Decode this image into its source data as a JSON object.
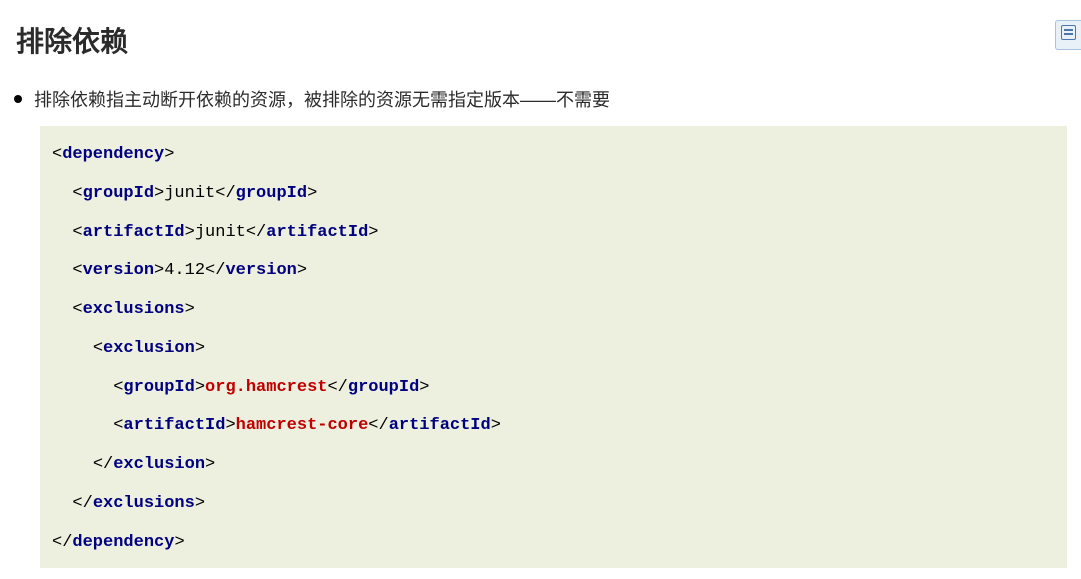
{
  "title": "排除依赖",
  "bullet": "排除依赖指主动断开依赖的资源，被排除的资源无需指定版本——不需要",
  "code": {
    "lines": [
      {
        "indent": 0,
        "open": "dependency",
        "close": null,
        "content": null,
        "contentClass": null
      },
      {
        "indent": 1,
        "open": "groupId",
        "close": "groupId",
        "content": "junit",
        "contentClass": "txt"
      },
      {
        "indent": 1,
        "open": "artifactId",
        "close": "artifactId",
        "content": "junit",
        "contentClass": "txt"
      },
      {
        "indent": 1,
        "open": "version",
        "close": "version",
        "content": "4.12",
        "contentClass": "txt"
      },
      {
        "indent": 1,
        "open": "exclusions",
        "close": null,
        "content": null,
        "contentClass": null
      },
      {
        "indent": 2,
        "open": "exclusion",
        "close": null,
        "content": null,
        "contentClass": null
      },
      {
        "indent": 3,
        "open": "groupId",
        "close": "groupId",
        "content": "org.hamcrest",
        "contentClass": "hl"
      },
      {
        "indent": 3,
        "open": "artifactId",
        "close": "artifactId",
        "content": "hamcrest-core",
        "contentClass": "hl"
      },
      {
        "indent": 2,
        "open": null,
        "close": "exclusion",
        "content": null,
        "contentClass": null
      },
      {
        "indent": 1,
        "open": null,
        "close": "exclusions",
        "content": null,
        "contentClass": null
      },
      {
        "indent": 0,
        "open": null,
        "close": "dependency",
        "content": null,
        "contentClass": null
      }
    ]
  },
  "sideWidget": {
    "iconName": "notes-icon"
  }
}
